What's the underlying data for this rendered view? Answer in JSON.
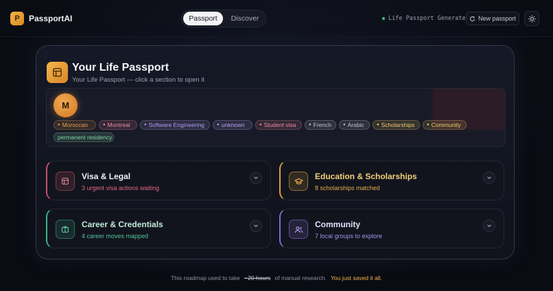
{
  "app": {
    "logo_letter": "P",
    "name": "PassportAI"
  },
  "tabs": [
    {
      "label": "Passport",
      "active": true
    },
    {
      "label": "Discover",
      "active": false
    }
  ],
  "status": {
    "text": "Life Passport Generated",
    "color": "#37d07a"
  },
  "new_passport_label": "New passport",
  "passport": {
    "title": "Your Life Passport",
    "subtitle": "Your Life Passport — click a section to open it",
    "avatar_letter": "M",
    "tags": [
      {
        "label": "Moroccan",
        "color": "#ef9e4c"
      },
      {
        "label": "Montreal",
        "color": "#f08aa2"
      },
      {
        "label": "Software Engineering",
        "color": "#b39cf2"
      },
      {
        "label": "unknown",
        "color": "#b9a3f0"
      },
      {
        "label": "Student visa",
        "color": "#f08aa2"
      },
      {
        "label": "French",
        "color": "#c3c6d1"
      },
      {
        "label": "Arabic",
        "color": "#c3c6d1"
      },
      {
        "label": "Scholarships",
        "color": "#f3cc6a"
      },
      {
        "label": "Community",
        "color": "#f3cc6a"
      },
      {
        "label": "permanent residency",
        "color": "#7fd8a6"
      }
    ]
  },
  "sections": [
    {
      "title": "Visa & Legal",
      "subtitle": "3 urgent visa actions waiting",
      "icon": "document-icon",
      "accent": "#e0607a"
    },
    {
      "title": "Education & Scholarships",
      "subtitle": "8 scholarships matched",
      "icon": "graduation-cap-icon",
      "accent": "#f3b648"
    },
    {
      "title": "Career & Credentials",
      "subtitle": "4 career moves mapped",
      "icon": "briefcase-icon",
      "accent": "#45c79a"
    },
    {
      "title": "Community",
      "subtitle": "7 local groups to explore",
      "icon": "users-icon",
      "accent": "#9a7cf0"
    }
  ],
  "footer": {
    "before": "This roadmap used to take",
    "struck": "~20 hours",
    "after": "of manual research.",
    "highlight": "You just saved it all."
  }
}
